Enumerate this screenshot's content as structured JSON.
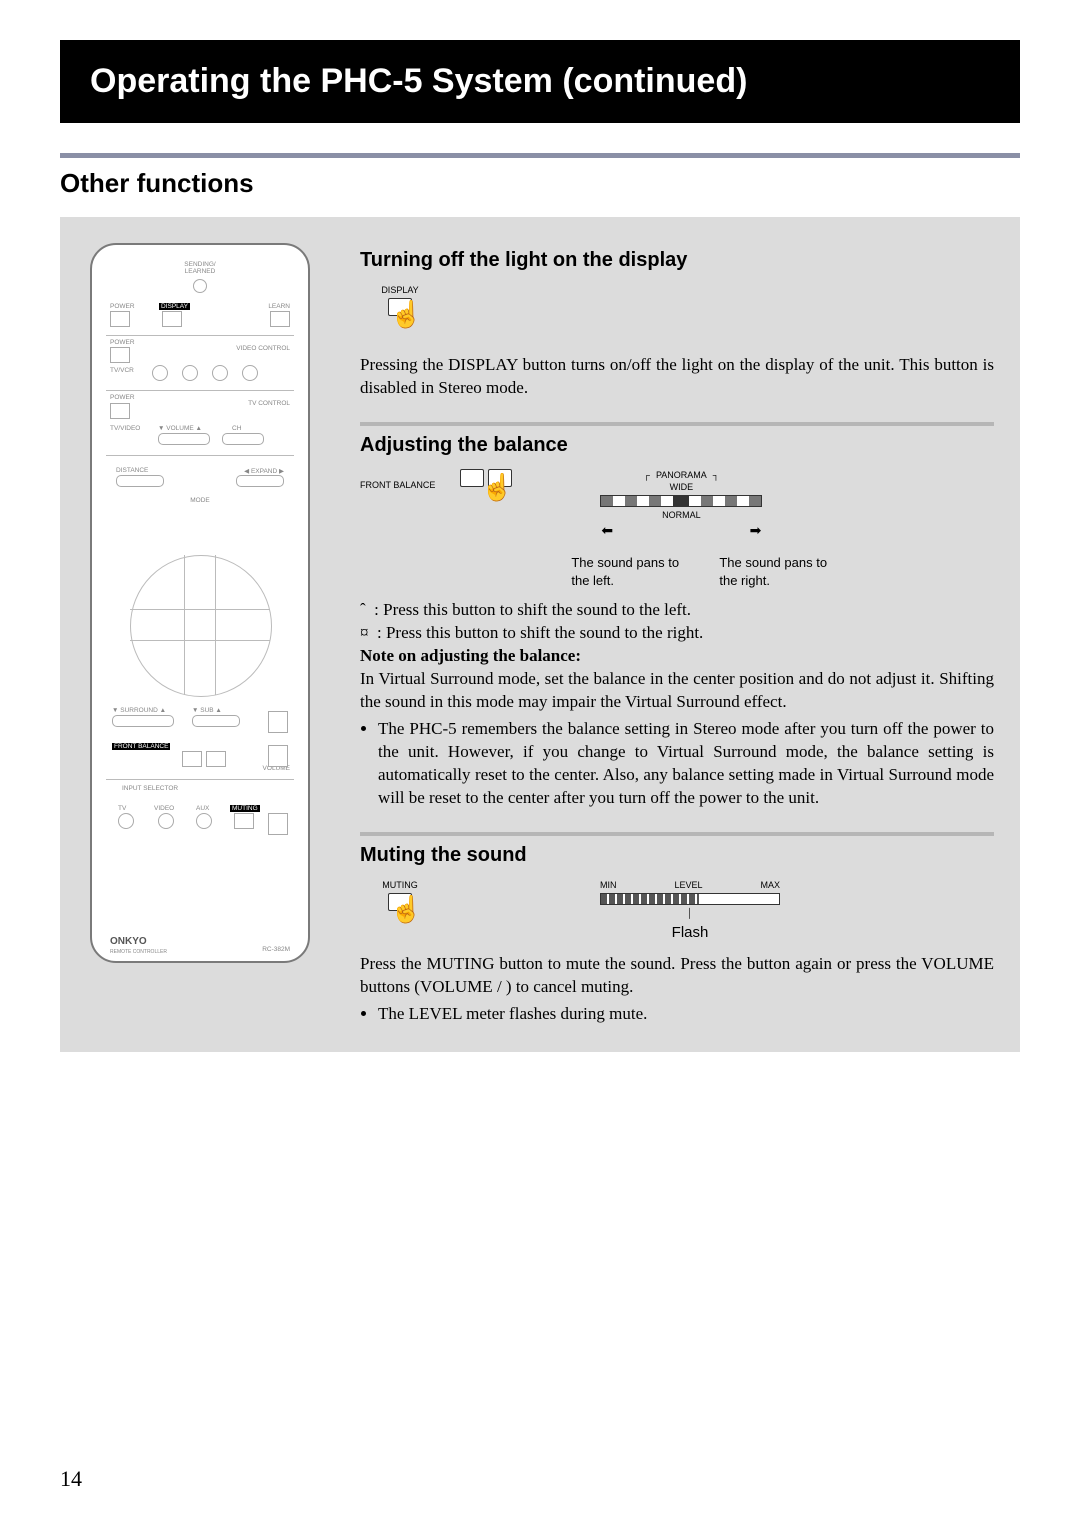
{
  "page_number": "14",
  "title": "Operating the PHC-5 System (continued)",
  "section": "Other functions",
  "remote": {
    "led_label": "SENDING/\nLEARNED",
    "row1": {
      "power": "POWER",
      "display": "DISPLAY",
      "learn": "LEARN"
    },
    "video_ctrl": "VIDEO CONTROL",
    "row2": {
      "power": "POWER",
      "tvvcr": "TV/VCR"
    },
    "tv_ctrl": "TV CONTROL",
    "row3": {
      "power": "POWER",
      "tvvideo": "TV/VIDEO",
      "volume": "▼ VOLUME ▲",
      "ch": "CH"
    },
    "dpad": {
      "distance": "DISTANCE",
      "expand": "◀ EXPAND ▶",
      "mode": "MODE"
    },
    "surround": "▼ SURROUND ▲",
    "sub": "▼ SUB ▲",
    "front_balance": "FRONT BALANCE",
    "volume_label": "VOLUME",
    "input_selector": "INPUT SELECTOR",
    "inputs": {
      "tv": "TV",
      "video": "VIDEO",
      "aux": "AUX",
      "muting": "MUTING"
    },
    "brand": "ONKYO",
    "brand_sub": "REMOTE CONTROLLER",
    "model": "RC-382M"
  },
  "sub1": {
    "heading": "Turning off the light on the display",
    "btn_label": "DISPLAY",
    "para": "Pressing the DISPLAY button turns on/off the light on the display of the unit. This button is disabled in Stereo mode."
  },
  "sub2": {
    "heading": "Adjusting the balance",
    "btn_label": "FRONT BALANCE",
    "meter": {
      "panorama": "PANORAMA",
      "wide": "WIDE",
      "normal": "NORMAL"
    },
    "left_cap": "The sound pans to the left.",
    "right_cap": "The sound pans to the right.",
    "line_left": ": Press this button to shift the sound to the left.",
    "line_right": ": Press this button to shift the sound to the right.",
    "note_head": "Note on adjusting the balance:",
    "note_body": "In Virtual Surround mode, set the balance in the center position and do not adjust it. Shifting the sound in this mode may impair the Virtual Surround effect.",
    "bullet": "The PHC-5 remembers the balance setting in Stereo mode after you turn off the power to the unit. However, if you change to Virtual Surround mode, the balance setting is automatically reset to the center. Also, any balance setting made in Virtual Surround mode will be reset to the center after you turn off the power to the unit."
  },
  "sub3": {
    "heading": "Muting the sound",
    "btn_label": "MUTING",
    "meter": {
      "min": "MIN",
      "level": "LEVEL",
      "max": "MAX",
      "flash": "Flash"
    },
    "para": "Press the MUTING button to mute the sound. Press the button again or press the VOLUME buttons (VOLUME   /   ) to cancel muting.",
    "bullet": "The LEVEL meter flashes during mute."
  }
}
